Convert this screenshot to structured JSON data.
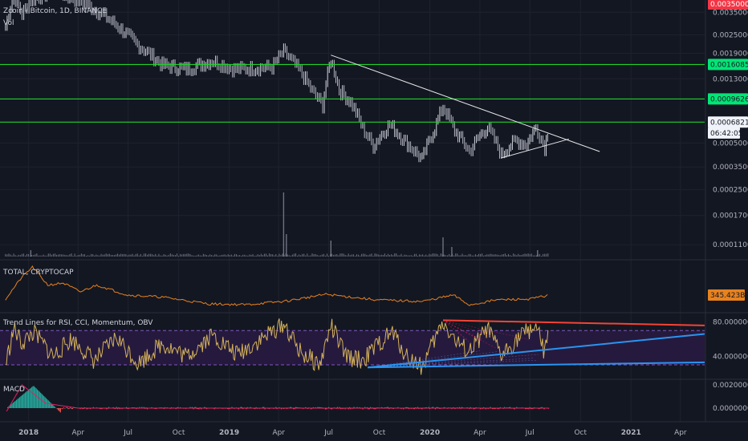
{
  "colors": {
    "background": "#131722",
    "axis_text": "#b2b5be",
    "grid": "#1e222d",
    "separator": "#2a2e39",
    "candle_up": "#d1d4dc",
    "candle_down": "#b2b5be",
    "hline": "#1fd12a",
    "trendline": "#e6e6e6",
    "volume": "#6e7281",
    "total_line": "#e8821e",
    "rsi_line": "#d4b25a",
    "rsi_band": "#251a3d",
    "rsi_band_edge": "#7e57c2",
    "trend_red": "#f44336",
    "trend_blue": "#2a94f0",
    "macd_hist_up": "#26a69a",
    "macd_hist_down": "#ef5350",
    "badge_green": "#00e676",
    "badge_red": "#f23645",
    "badge_white": "#f0f3fa"
  },
  "header": {
    "symbol_title": "Zcoin / Bitcoin, 1D, BINANCE",
    "volume_label": "Vol"
  },
  "chart_data": [
    {
      "type": "line",
      "name": "price-pane",
      "title": "Zcoin / Bitcoin, 1D, BINANCE",
      "y_scale": "log",
      "ylim": [
        9e-05,
        0.0042
      ],
      "y_ticks": [
        "0.0035000",
        "0.0025000",
        "0.0019000",
        "0.0013000",
        "0.0005000",
        "0.0003500",
        "0.0002500",
        "0.0001700",
        "0.0001100"
      ],
      "x_ticks": [
        "2018",
        "Apr",
        "Jul",
        "Oct",
        "2019",
        "Apr",
        "Jul",
        "Oct",
        "2020",
        "Apr",
        "Jul",
        "Oct",
        "2021",
        "Apr"
      ],
      "x_range": [
        "2017-11-10",
        "2021-05-15"
      ],
      "price_path": [
        [
          "2017-11-20",
          0.0028
        ],
        [
          "2017-12-05",
          0.0045
        ],
        [
          "2017-12-20",
          0.0034
        ],
        [
          "2018-01-05",
          0.0042
        ],
        [
          "2018-02-15",
          0.0048
        ],
        [
          "2018-04-01",
          0.0042
        ],
        [
          "2018-05-20",
          0.0033
        ],
        [
          "2018-07-15",
          0.0022
        ],
        [
          "2018-09-01",
          0.0016
        ],
        [
          "2018-10-15",
          0.0015
        ],
        [
          "2018-12-01",
          0.0017
        ],
        [
          "2019-01-10",
          0.0015
        ],
        [
          "2019-03-20",
          0.00155
        ],
        [
          "2019-04-10",
          0.00195
        ],
        [
          "2019-05-01",
          0.0016
        ],
        [
          "2019-06-01",
          0.00108
        ],
        [
          "2019-06-20",
          0.00088
        ],
        [
          "2019-07-05",
          0.00172
        ],
        [
          "2019-07-20",
          0.0011
        ],
        [
          "2019-08-10",
          0.00092
        ],
        [
          "2019-09-01",
          0.00062
        ],
        [
          "2019-09-20",
          0.00048
        ],
        [
          "2019-10-20",
          0.00066
        ],
        [
          "2019-11-15",
          0.00052
        ],
        [
          "2019-12-18",
          0.00039
        ],
        [
          "2020-01-10",
          0.00062
        ],
        [
          "2020-01-25",
          0.00086
        ],
        [
          "2020-02-15",
          0.0006
        ],
        [
          "2020-03-13",
          0.00044
        ],
        [
          "2020-04-01",
          0.00056
        ],
        [
          "2020-04-15",
          0.00063
        ],
        [
          "2020-05-10",
          0.00042
        ],
        [
          "2020-06-05",
          0.00052
        ],
        [
          "2020-06-25",
          0.00049
        ],
        [
          "2020-07-12",
          0.00063
        ],
        [
          "2020-07-28",
          0.00047
        ],
        [
          "2020-08-05",
          0.00064
        ]
      ],
      "horizontal_levels": [
        0.0016085,
        0.0009626,
        0.0006821
      ],
      "trendlines": [
        {
          "from": [
            "2019-07-05",
            0.00185
          ],
          "to": [
            "2020-11-05",
            0.00044
          ]
        },
        {
          "from": [
            "2020-05-10",
            0.0004
          ],
          "to": [
            "2020-09-10",
            0.00053
          ]
        }
      ],
      "price_badges": [
        {
          "label": "0.0035000",
          "kind": "red",
          "value": 0.0042
        },
        {
          "label": "0.0016085",
          "kind": "green",
          "value": 0.0016085
        },
        {
          "label": "0.0009626",
          "kind": "green",
          "value": 0.0009626
        },
        {
          "label": "0.0006821",
          "kind": "white",
          "value": 0.0006821
        },
        {
          "label": "06:42:05",
          "kind": "white_small",
          "value": 0.00058
        }
      ]
    },
    {
      "type": "bar",
      "name": "volume",
      "title": "Vol",
      "spikes": [
        [
          "2018-01-05",
          0.1
        ],
        [
          "2019-04-10",
          1.0
        ],
        [
          "2019-04-15",
          0.35
        ],
        [
          "2019-07-05",
          0.25
        ],
        [
          "2020-01-25",
          0.3
        ],
        [
          "2020-02-10",
          0.15
        ],
        [
          "2020-07-15",
          0.1
        ]
      ]
    },
    {
      "type": "line",
      "name": "total-cryptocap",
      "title": "TOTAL, CRYPTOCAP",
      "last_value_label": "345.423B",
      "path": [
        [
          "2017-11-20",
          0.2
        ],
        [
          "2017-12-20",
          0.75
        ],
        [
          "2018-01-08",
          1.0
        ],
        [
          "2018-02-05",
          0.55
        ],
        [
          "2018-03-05",
          0.6
        ],
        [
          "2018-04-05",
          0.38
        ],
        [
          "2018-05-05",
          0.55
        ],
        [
          "2018-06-30",
          0.3
        ],
        [
          "2018-09-01",
          0.25
        ],
        [
          "2018-11-25",
          0.08
        ],
        [
          "2019-02-01",
          0.06
        ],
        [
          "2019-04-15",
          0.15
        ],
        [
          "2019-06-26",
          0.32
        ],
        [
          "2019-09-25",
          0.18
        ],
        [
          "2019-12-18",
          0.14
        ],
        [
          "2020-02-13",
          0.3
        ],
        [
          "2020-03-13",
          0.05
        ],
        [
          "2020-05-01",
          0.18
        ],
        [
          "2020-07-01",
          0.2
        ],
        [
          "2020-08-05",
          0.3
        ]
      ]
    },
    {
      "type": "line",
      "name": "rsi-trendlines",
      "title": "Trend Lines for RSI, CCI, Momentum, OBV",
      "ylim": [
        16,
        88
      ],
      "y_ticks": [
        "80.0000000",
        "40.0000000"
      ],
      "band": [
        30,
        70
      ],
      "path": [
        [
          "2017-11-20",
          30
        ],
        [
          "2017-12-05",
          72
        ],
        [
          "2017-12-20",
          55
        ],
        [
          "2018-01-10",
          68
        ],
        [
          "2018-02-15",
          40
        ],
        [
          "2018-03-20",
          60
        ],
        [
          "2018-05-01",
          35
        ],
        [
          "2018-06-10",
          62
        ],
        [
          "2018-07-20",
          32
        ],
        [
          "2018-09-01",
          55
        ],
        [
          "2018-10-15",
          40
        ],
        [
          "2018-12-01",
          65
        ],
        [
          "2019-01-15",
          42
        ],
        [
          "2019-03-01",
          60
        ],
        [
          "2019-04-10",
          78
        ],
        [
          "2019-05-10",
          45
        ],
        [
          "2019-06-15",
          30
        ],
        [
          "2019-07-05",
          76
        ],
        [
          "2019-08-01",
          40
        ],
        [
          "2019-09-01",
          35
        ],
        [
          "2019-10-01",
          55
        ],
        [
          "2019-10-25",
          68
        ],
        [
          "2019-11-20",
          40
        ],
        [
          "2019-12-18",
          28
        ],
        [
          "2020-01-25",
          80
        ],
        [
          "2020-02-20",
          55
        ],
        [
          "2020-03-13",
          45
        ],
        [
          "2020-04-15",
          72
        ],
        [
          "2020-05-10",
          40
        ],
        [
          "2020-06-10",
          62
        ],
        [
          "2020-07-12",
          76
        ],
        [
          "2020-07-28",
          42
        ],
        [
          "2020-08-05",
          70
        ]
      ],
      "trend_lines": [
        {
          "color": "red",
          "from": [
            "2020-01-25",
            82
          ],
          "to": [
            "2021-05-15",
            76
          ]
        },
        {
          "color": "blue",
          "from": [
            "2019-09-10",
            27
          ],
          "to": [
            "2021-05-15",
            66
          ]
        },
        {
          "color": "blue",
          "from": [
            "2019-09-10",
            27
          ],
          "to": [
            "2021-05-15",
            33
          ]
        }
      ]
    },
    {
      "type": "bar",
      "name": "macd",
      "title": "MACD",
      "y_ticks": [
        "0.0020000",
        "0.0000000"
      ]
    }
  ]
}
